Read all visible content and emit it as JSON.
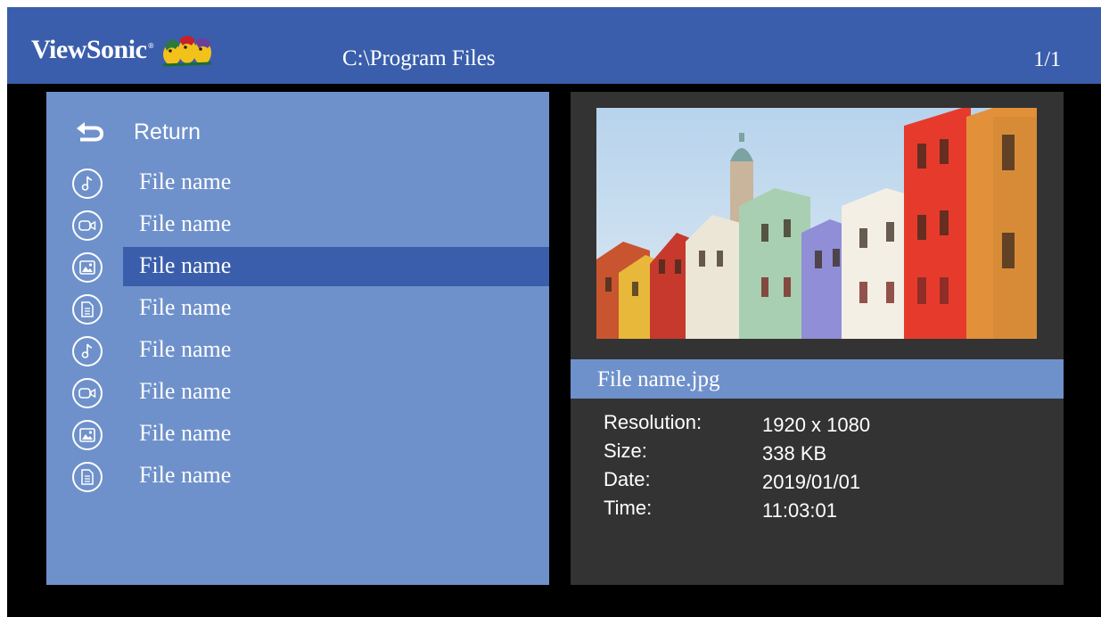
{
  "header": {
    "logo_text": "ViewSonic",
    "logo_mark": "®",
    "path": "C:\\Program Files",
    "page_indicator": "1/1"
  },
  "list": {
    "return_label": "Return",
    "items": [
      {
        "icon": "music-icon",
        "label": "File name",
        "selected": false
      },
      {
        "icon": "video-icon",
        "label": "File name",
        "selected": false
      },
      {
        "icon": "photo-icon",
        "label": "File name",
        "selected": true
      },
      {
        "icon": "document-icon",
        "label": "File name",
        "selected": false
      },
      {
        "icon": "music-icon",
        "label": "File name",
        "selected": false
      },
      {
        "icon": "video-icon",
        "label": "File name",
        "selected": false
      },
      {
        "icon": "photo-icon",
        "label": "File name",
        "selected": false
      },
      {
        "icon": "document-icon",
        "label": "File name",
        "selected": false
      }
    ]
  },
  "preview": {
    "file_name": "File name.jpg",
    "info": [
      {
        "label": "Resolution:",
        "value": "1920 x 1080"
      },
      {
        "label": "Size:",
        "value": "338 KB"
      },
      {
        "label": "Date:",
        "value": "2019/01/01"
      },
      {
        "label": "Time:",
        "value": "11:03:01"
      }
    ]
  },
  "colors": {
    "header": "#3a5eab",
    "list_panel": "#6f91cb",
    "selection": "#3a5eab",
    "preview_panel": "#333333",
    "background": "#000000"
  }
}
